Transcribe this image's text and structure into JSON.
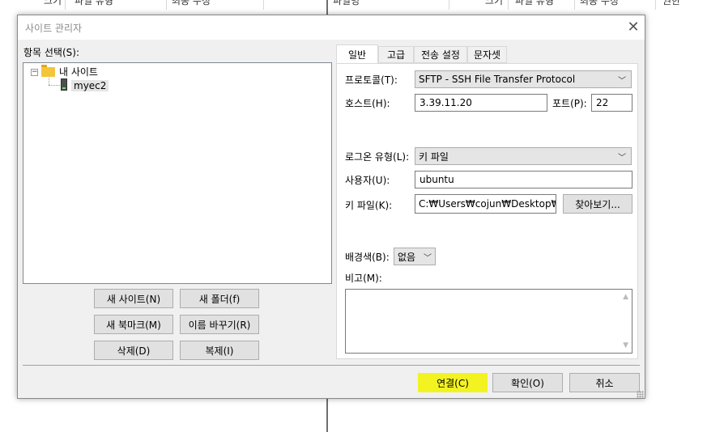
{
  "background": {
    "left_headers": [
      "크기",
      "파일 유형",
      "최종 수정"
    ],
    "right_headers": [
      "파일명",
      "크기",
      "파일 유형",
      "최종 수정",
      "권한"
    ]
  },
  "dialog": {
    "title": "사이트 관리자",
    "close_icon": "close-icon",
    "tree_label": "항목 선택(S):",
    "tree": {
      "root": "내 사이트",
      "child": "myec2"
    },
    "buttons": {
      "new_site": "새 사이트(N)",
      "new_folder": "새 폴더(f)",
      "new_bookmark": "새 북마크(M)",
      "rename": "이름 바꾸기(R)",
      "delete": "삭제(D)",
      "duplicate": "복제(I)"
    },
    "tabs": [
      "일반",
      "고급",
      "전송 설정",
      "문자셋"
    ],
    "active_tab": "일반",
    "general": {
      "protocol_label": "프로토콜(T):",
      "protocol_value": "SFTP - SSH File Transfer Protocol",
      "host_label": "호스트(H):",
      "host_value": "3.39.11.20",
      "port_label": "포트(P):",
      "port_value": "22",
      "logon_label": "로그온 유형(L):",
      "logon_value": "키 파일",
      "user_label": "사용자(U):",
      "user_value": "ubuntu",
      "keyfile_label": "키 파일(K):",
      "keyfile_value": "C:₩Users₩cojun₩Desktop₩coj",
      "browse": "찾아보기...",
      "bgcolor_label": "배경색(B):",
      "bgcolor_value": "없음",
      "comment_label": "비고(M):"
    },
    "footer": {
      "connect": "연결(C)",
      "ok": "확인(O)",
      "cancel": "취소"
    },
    "colors": {
      "highlight": "#f3f321"
    }
  }
}
